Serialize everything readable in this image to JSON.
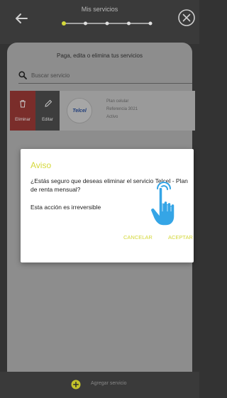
{
  "header": {
    "title": "Mis servicios",
    "stepper": {
      "steps": 5,
      "current_step": 1
    }
  },
  "content": {
    "subtitle": "Paga, edita o elimina tus servicios",
    "search": {
      "placeholder": "Buscar servicio"
    },
    "service_row": {
      "delete_label": "Eliminar",
      "edit_label": "Editar",
      "logo_text": "Telcel",
      "service_type": "Plan celular",
      "reference": "Referencia 3021",
      "status": "Activo"
    }
  },
  "bottom_bar": {
    "add_label": "Agregar servicio"
  },
  "dialog": {
    "title": "Aviso",
    "message": "¿Estás seguro que deseas eliminar el servicio Telcel - Plan de renta mensual?",
    "warning": "Esta acción es irreversible",
    "cancel_label": "CANCELAR",
    "accept_label": "ACEPTAR"
  },
  "colors": {
    "accent": "#d4d83a",
    "delete_bg": "#7a2d2a",
    "edit_bg": "#3d3d3d",
    "overlay_bg": "#333333",
    "sheet_bg": "#8d8d8d",
    "hand_fill": "#35a5e6"
  },
  "icons": {
    "back": "arrow-left-icon",
    "close": "circle-x-icon",
    "search": "search-icon",
    "delete": "trash-icon",
    "edit": "pencil-icon",
    "add": "plus-circle-icon",
    "tap": "tap-hand-icon"
  }
}
